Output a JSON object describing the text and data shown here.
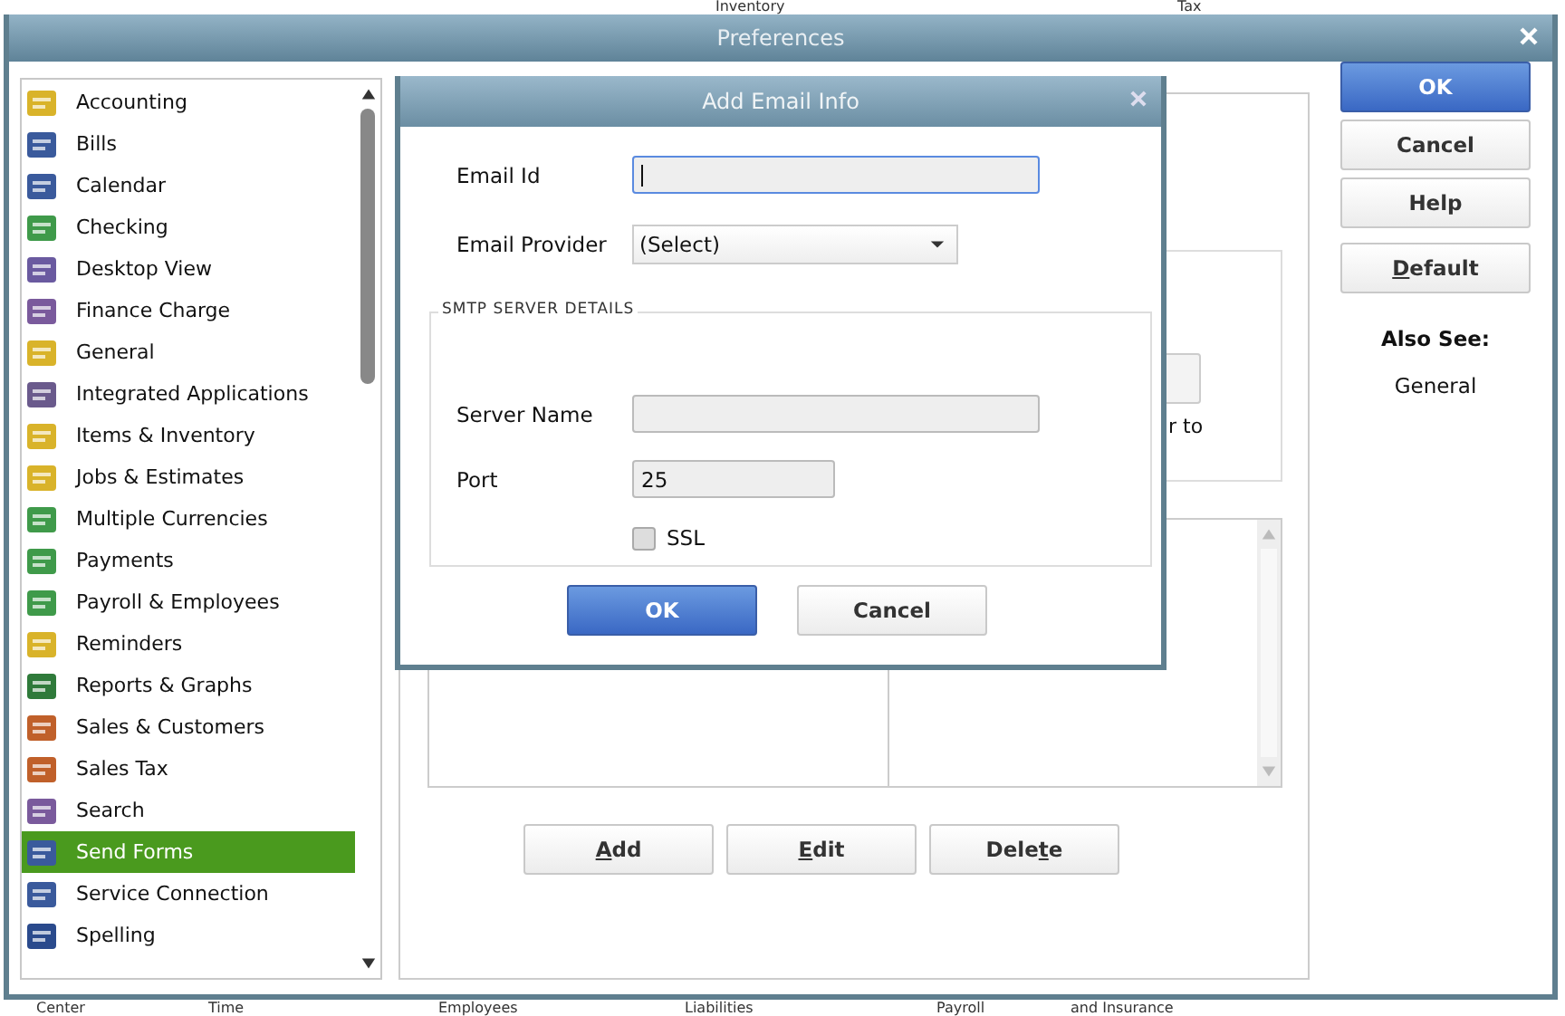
{
  "background": {
    "top_texts": [
      "Inventory",
      "Tax"
    ],
    "bottom_texts": [
      "Center",
      "Time",
      "Employees",
      "Liabilities",
      "Payroll",
      "and Insurance"
    ]
  },
  "window": {
    "title": "Preferences"
  },
  "sidebar": {
    "items": [
      {
        "label": "Accounting",
        "selected": false
      },
      {
        "label": "Bills",
        "selected": false
      },
      {
        "label": "Calendar",
        "selected": false
      },
      {
        "label": "Checking",
        "selected": false
      },
      {
        "label": "Desktop View",
        "selected": false
      },
      {
        "label": "Finance Charge",
        "selected": false
      },
      {
        "label": "General",
        "selected": false
      },
      {
        "label": "Integrated Applications",
        "selected": false
      },
      {
        "label": "Items & Inventory",
        "selected": false
      },
      {
        "label": "Jobs & Estimates",
        "selected": false
      },
      {
        "label": "Multiple Currencies",
        "selected": false
      },
      {
        "label": "Payments",
        "selected": false
      },
      {
        "label": "Payroll & Employees",
        "selected": false
      },
      {
        "label": "Reminders",
        "selected": false
      },
      {
        "label": "Reports & Graphs",
        "selected": false
      },
      {
        "label": "Sales & Customers",
        "selected": false
      },
      {
        "label": "Sales Tax",
        "selected": false
      },
      {
        "label": "Search",
        "selected": false
      },
      {
        "label": "Send Forms",
        "selected": true
      },
      {
        "label": "Service Connection",
        "selected": false
      },
      {
        "label": "Spelling",
        "selected": false
      }
    ]
  },
  "panel": {
    "partial_text": "r to",
    "buttons": [
      {
        "label": "Add"
      },
      {
        "label": "Edit"
      },
      {
        "label": "Delete"
      }
    ]
  },
  "actions": {
    "buttons": [
      {
        "label": "OK",
        "kind": "primary"
      },
      {
        "label": "Cancel",
        "kind": "normal"
      },
      {
        "label": "Help",
        "kind": "normal"
      },
      {
        "label": "Default",
        "kind": "normal"
      }
    ],
    "also_see_title": "Also See:",
    "also_see_links": [
      "General"
    ]
  },
  "dialog": {
    "title": "Add Email Info",
    "email_id": {
      "label": "Email Id",
      "focused": true
    },
    "provider": {
      "label": "Email Provider",
      "value": "(Select)"
    },
    "group_title": "SMTP SERVER DETAILS",
    "server_name": {
      "label": "Server Name"
    },
    "port": {
      "label": "Port",
      "value": "25"
    },
    "ssl": {
      "label": "SSL",
      "checked": false
    },
    "buttons": [
      {
        "label": "OK",
        "kind": "primary"
      },
      {
        "label": "Cancel",
        "kind": "normal"
      }
    ]
  }
}
